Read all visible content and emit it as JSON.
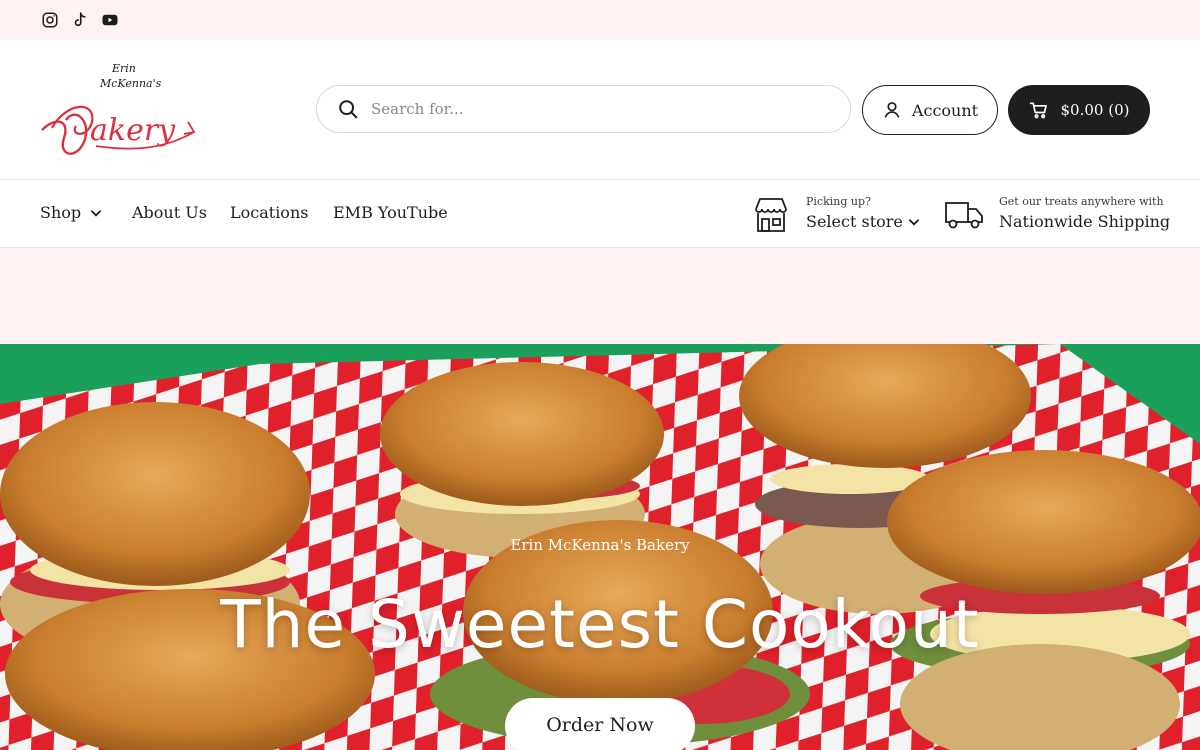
{
  "social": {
    "instagram_icon": "instagram-icon",
    "tiktok_icon": "tiktok-icon",
    "youtube_icon": "youtube-icon"
  },
  "header": {
    "logo_text_top": "Erin McKenna's",
    "logo_text_main": "Bakery",
    "search_placeholder": "Search for...",
    "account_label": "Account",
    "cart_label": "$0.00 (0)"
  },
  "nav": {
    "items": [
      {
        "label": "Shop"
      },
      {
        "label": "About Us"
      },
      {
        "label": "Locations"
      },
      {
        "label": "EMB YouTube"
      }
    ],
    "pickup_small": "Picking up?",
    "pickup_big": "Select store",
    "shipping_small": "Get our treats anywhere with",
    "shipping_big": "Nationwide Shipping"
  },
  "hero": {
    "kicker": "Erin McKenna's Bakery",
    "title": "The Sweetest Cookout",
    "button_label": "Order Now"
  },
  "colors": {
    "brand_red": "#d9323f",
    "dark": "#1e1e1e",
    "pink_band": "#fff3f3",
    "hero_green": "#1aa05a"
  }
}
